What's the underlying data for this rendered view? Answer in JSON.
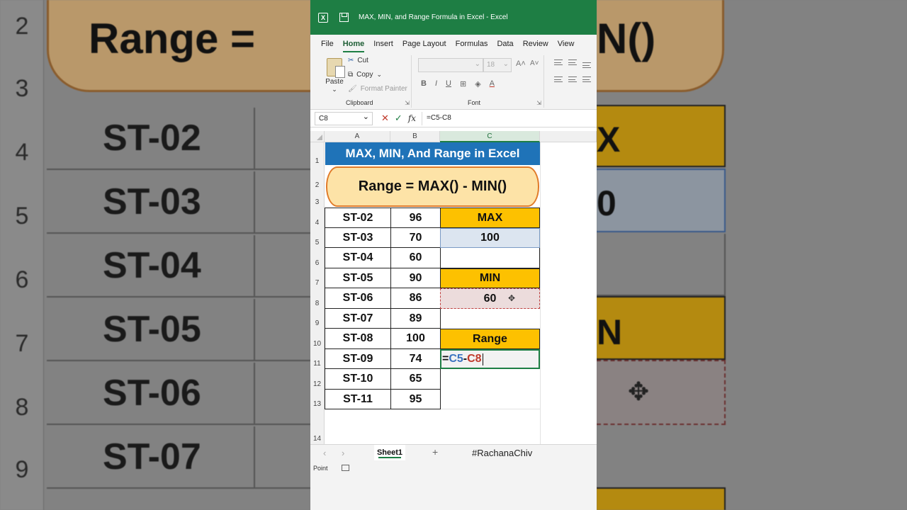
{
  "window": {
    "title": "MAX, MIN, and Range Formula in Excel  -  Excel"
  },
  "menu": [
    "File",
    "Home",
    "Insert",
    "Page Layout",
    "Formulas",
    "Data",
    "Review",
    "View"
  ],
  "clipboard": {
    "paste": "Paste",
    "cut": "Cut",
    "copy": "Copy",
    "format_painter": "Format Painter",
    "label": "Clipboard"
  },
  "font": {
    "size": "18",
    "label": "Font",
    "bold": "B",
    "italic": "I",
    "underline": "U"
  },
  "formula_bar": {
    "name_box": "C8",
    "formula": "=C5-C8"
  },
  "columns": [
    "A",
    "B",
    "C"
  ],
  "rows": [
    "1",
    "2",
    "3",
    "4",
    "5",
    "6",
    "7",
    "8",
    "9",
    "10",
    "11",
    "12",
    "13",
    "14"
  ],
  "sheet": {
    "title": "MAX, MIN, And Range in Excel",
    "formula_label": "Range = MAX() - MIN()",
    "students": [
      {
        "id": "ST-02",
        "score": "96"
      },
      {
        "id": "ST-03",
        "score": "70"
      },
      {
        "id": "ST-04",
        "score": "60"
      },
      {
        "id": "ST-05",
        "score": "90"
      },
      {
        "id": "ST-06",
        "score": "86"
      },
      {
        "id": "ST-07",
        "score": "89"
      },
      {
        "id": "ST-08",
        "score": "100"
      },
      {
        "id": "ST-09",
        "score": "74"
      },
      {
        "id": "ST-10",
        "score": "65"
      },
      {
        "id": "ST-11",
        "score": "95"
      }
    ],
    "max_label": "MAX",
    "max_value": "100",
    "min_label": "MIN",
    "min_value": "60",
    "range_label": "Range",
    "range_formula": {
      "eq": "=",
      "ref1": "C5",
      "op": "-",
      "ref2": "C8"
    }
  },
  "sheet_tab": "Sheet1",
  "watermark": "#RachanaChiv",
  "status": {
    "mode": "Point"
  },
  "background": {
    "banner_left": "Range =",
    "banner_right": "N()",
    "row_numbers": [
      "2",
      "3",
      "4",
      "5",
      "6",
      "7",
      "8",
      "9"
    ],
    "ids": [
      "ST-02",
      "ST-03",
      "ST-04",
      "ST-05",
      "ST-06",
      "ST-07"
    ],
    "right_letters": [
      "X",
      "0",
      "N"
    ]
  },
  "colors": {
    "excel_green": "#1e7e44",
    "title_blue": "#1f73b8",
    "gold": "#fdc100",
    "pill": "#fde3a7",
    "pill_border": "#e07b2a"
  }
}
